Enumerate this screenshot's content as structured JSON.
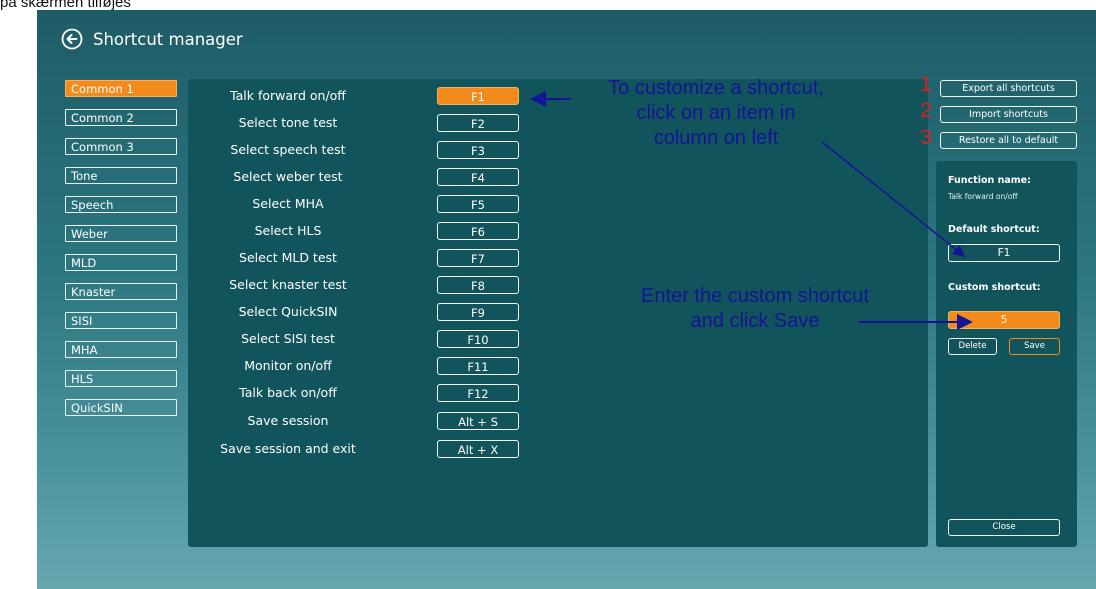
{
  "document_text": "på skærmen tilføjes",
  "header": {
    "title": "Shortcut manager",
    "back_icon": "back-arrow-circle-icon"
  },
  "categories": [
    "Common 1",
    "Common 2",
    "Common 3",
    "Tone",
    "Speech",
    "Weber",
    "MLD",
    "Knaster",
    "SISI",
    "MHA",
    "HLS",
    "QuickSIN"
  ],
  "shortcuts": [
    {
      "label": "Talk forward on/off",
      "key": "F1"
    },
    {
      "label": "Select tone test",
      "key": "F2"
    },
    {
      "label": "Select speech test",
      "key": "F3"
    },
    {
      "label": "Select weber test",
      "key": "F4"
    },
    {
      "label": "Select MHA",
      "key": "F5"
    },
    {
      "label": "Select HLS",
      "key": "F6"
    },
    {
      "label": "Select MLD test",
      "key": "F7"
    },
    {
      "label": "Select knaster test",
      "key": "F8"
    },
    {
      "label": "Select QuickSIN",
      "key": "F9"
    },
    {
      "label": "Select SISI test",
      "key": "F10"
    },
    {
      "label": "Monitor on/off",
      "key": "F11"
    },
    {
      "label": "Talk back on/off",
      "key": "F12"
    },
    {
      "label": "Save session",
      "key": "Alt + S"
    },
    {
      "label": "Save session and exit",
      "key": "Alt + X"
    }
  ],
  "toolbar": {
    "export_label": "Export all shortcuts",
    "import_label": "Import shortcuts",
    "restore_label": "Restore all to default"
  },
  "markers": [
    "1",
    "2",
    "3"
  ],
  "details": {
    "function_name_label": "Function name:",
    "function_name_value": "Talk forward on/off",
    "default_shortcut_label": "Default shortcut:",
    "default_shortcut_value": "F1",
    "custom_shortcut_label": "Custom shortcut:",
    "custom_shortcut_value": "5",
    "delete_label": "Delete",
    "save_label": "Save",
    "close_label": "Close"
  },
  "annotations": {
    "customize_line1": "To customize a shortcut,",
    "customize_line2": "click on an item in",
    "customize_line3": "column on left",
    "enter_line1": "Enter the custom shortcut",
    "enter_line2": "and click Save"
  },
  "colors": {
    "accent": "#f28a1c",
    "panel": "#12545c",
    "annotation": "#141496",
    "marker": "#e0201a"
  }
}
